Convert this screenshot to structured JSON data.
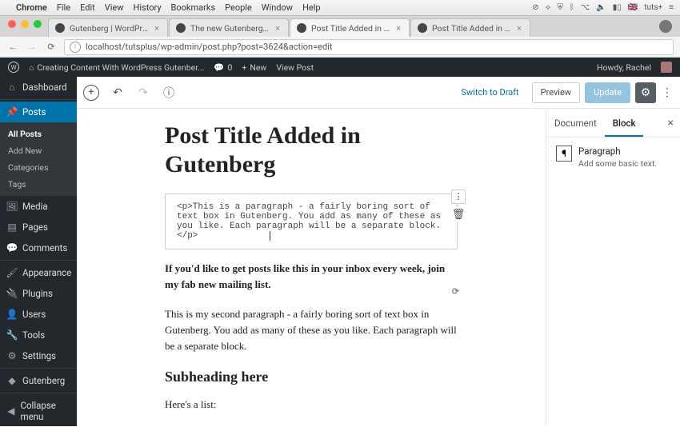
{
  "mac": {
    "apple": "",
    "app": "Chrome",
    "menu": [
      "File",
      "Edit",
      "View",
      "History",
      "Bookmarks",
      "People",
      "Window",
      "Help"
    ],
    "right": {
      "neg": "neg",
      "wifi": "wifi",
      "shield": "shield",
      "bt": "bt",
      "key": "key",
      "vol": "vol",
      "bat": "bat",
      "flag": "flag",
      "brand": "tuts+",
      "ham": "≡"
    }
  },
  "tabs": [
    {
      "label": "Gutenberg | WordPress.org",
      "active": false
    },
    {
      "label": "The new Gutenberg editing ex",
      "active": false
    },
    {
      "label": "Post Title Added in Gutenber",
      "active": true
    },
    {
      "label": "Post Title Added in Gutenberg",
      "active": false
    }
  ],
  "omnibox": {
    "url": "localhost/tutsplus/wp-admin/post.php?post=3624&action=edit"
  },
  "wpbar": {
    "site": "Creating Content With WordPress Gutenber...",
    "comments": "0",
    "new": "New",
    "view": "View Post",
    "howdy": "Howdy, Rachel"
  },
  "side": {
    "dashboard": "Dashboard",
    "posts": "Posts",
    "posts_sub": [
      "All Posts",
      "Add New",
      "Categories",
      "Tags"
    ],
    "media": "Media",
    "pages": "Pages",
    "comments": "Comments",
    "appearance": "Appearance",
    "plugins": "Plugins",
    "users": "Users",
    "tools": "Tools",
    "settings": "Settings",
    "gutenberg": "Gutenberg",
    "collapse": "Collapse menu"
  },
  "editor": {
    "switch": "Switch to Draft",
    "preview": "Preview",
    "update": "Update",
    "title": "Post Title Added in Gutenberg",
    "html": "<p>This is a paragraph - a fairly boring sort of text box in Gutenberg. You add as many of these as you like. Each paragraph will be a separate block.</p>",
    "bold": "If you'd like to get posts like this in your inbox every week, join my fab new mailing list.",
    "para2": "This is my second paragraph - a fairly boring sort of text box in Gutenberg. You add as many of these as you like. Each paragraph will be a separate block.",
    "subheading": "Subheading here",
    "listintro": "Here's a list:"
  },
  "inspector": {
    "tab_doc": "Document",
    "tab_block": "Block",
    "block_name": "Paragraph",
    "block_desc": "Add some basic text."
  }
}
